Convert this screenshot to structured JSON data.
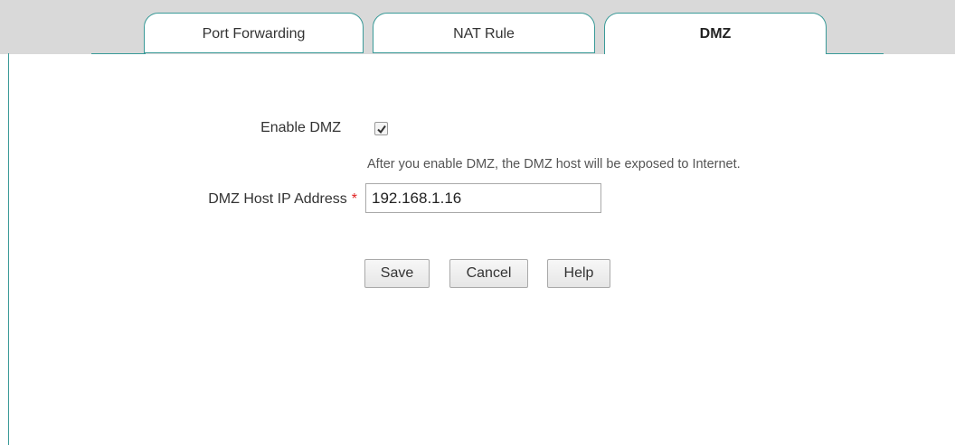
{
  "tabs": [
    {
      "label": "Port Forwarding",
      "active": false
    },
    {
      "label": "NAT Rule",
      "active": false
    },
    {
      "label": "DMZ",
      "active": true
    }
  ],
  "form": {
    "enable_dmz_label": "Enable DMZ",
    "enable_dmz_checked": true,
    "enable_hint": "After you enable DMZ, the DMZ host will be exposed to Internet.",
    "host_ip_label": "DMZ Host IP Address",
    "required_marker": "*",
    "host_ip_value": "192.168.1.16"
  },
  "buttons": {
    "save_label": "Save",
    "cancel_label": "Cancel",
    "help_label": "Help"
  },
  "colors": {
    "tab_border": "#3a9a98",
    "tab_bar_bg": "#d9d9d9",
    "required": "#e02020"
  }
}
